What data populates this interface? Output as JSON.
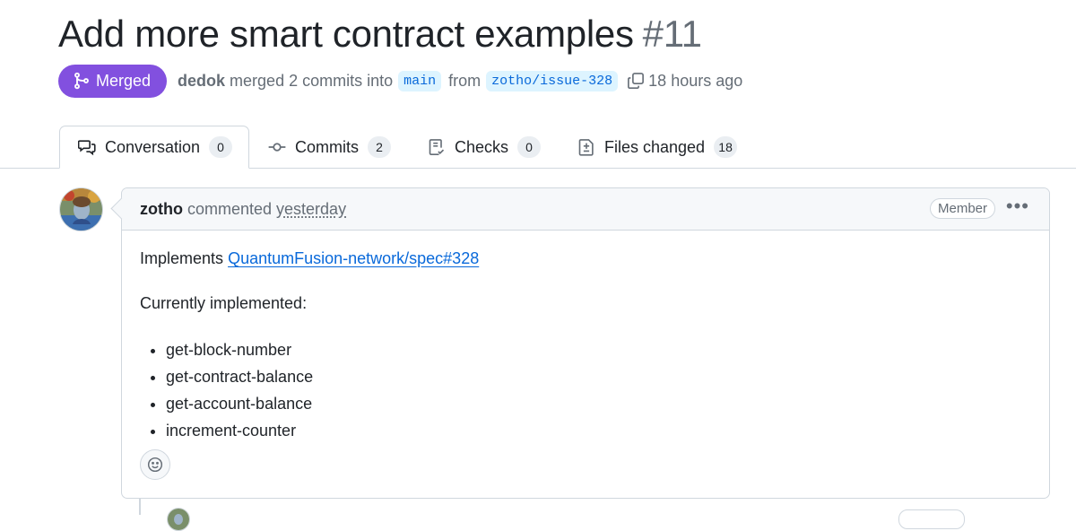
{
  "pr": {
    "title": "Add more smart contract examples",
    "number": "#11"
  },
  "meta": {
    "status_label": "Merged",
    "author": "dedok",
    "merged_text": "merged 2 commits into",
    "base_branch": "main",
    "from_text": "from",
    "head_branch": "zotho/issue-328",
    "time": "18 hours ago"
  },
  "tabs": [
    {
      "label": "Conversation",
      "count": "0",
      "icon": "comment-discussion-icon"
    },
    {
      "label": "Commits",
      "count": "2",
      "icon": "git-commit-icon"
    },
    {
      "label": "Checks",
      "count": "0",
      "icon": "checklist-icon"
    },
    {
      "label": "Files changed",
      "count": "18",
      "icon": "file-diff-icon"
    }
  ],
  "comment": {
    "user": "zotho",
    "action": "commented",
    "when": "yesterday",
    "role_badge": "Member",
    "more_label": "•••",
    "intro": "Implements",
    "link_text": "QuantumFusion-network/spec#328",
    "subheading": "Currently implemented:",
    "items": [
      "get-block-number",
      "get-contract-balance",
      "get-account-balance",
      "increment-counter"
    ]
  },
  "colors": {
    "merged": "#8250df",
    "link": "#0969da",
    "branch_bg": "#ddf4ff",
    "border": "#d0d7de"
  }
}
